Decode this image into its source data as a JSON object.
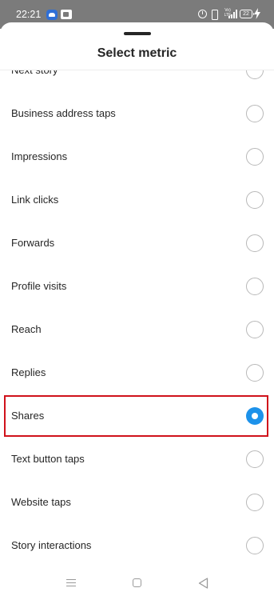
{
  "status_bar": {
    "time": "22:21",
    "battery": "22",
    "network_top": "Vo)",
    "network_bottom": "LTE"
  },
  "sheet": {
    "title": "Select metric"
  },
  "metrics": [
    {
      "label": "Next story",
      "selected": false
    },
    {
      "label": "Business address taps",
      "selected": false
    },
    {
      "label": "Impressions",
      "selected": false
    },
    {
      "label": "Link clicks",
      "selected": false
    },
    {
      "label": "Forwards",
      "selected": false
    },
    {
      "label": "Profile visits",
      "selected": false
    },
    {
      "label": "Reach",
      "selected": false
    },
    {
      "label": "Replies",
      "selected": false
    },
    {
      "label": "Shares",
      "selected": true
    },
    {
      "label": "Text button taps",
      "selected": false
    },
    {
      "label": "Website taps",
      "selected": false
    },
    {
      "label": "Story interactions",
      "selected": false
    }
  ],
  "colors": {
    "radio_selected": "#1d92ea",
    "highlight": "#d0121b",
    "status_bar": "#7b7b7b"
  },
  "icons": {
    "notification_1": "cloud-app-icon",
    "notification_2": "teams-icon",
    "alarm": "alarm-icon",
    "vibrate": "vibrate-icon",
    "signal": "signal-icon",
    "battery": "battery-icon",
    "charging": "charging-icon",
    "nav_menu": "menu-icon",
    "nav_home": "home-icon",
    "nav_back": "back-icon"
  }
}
